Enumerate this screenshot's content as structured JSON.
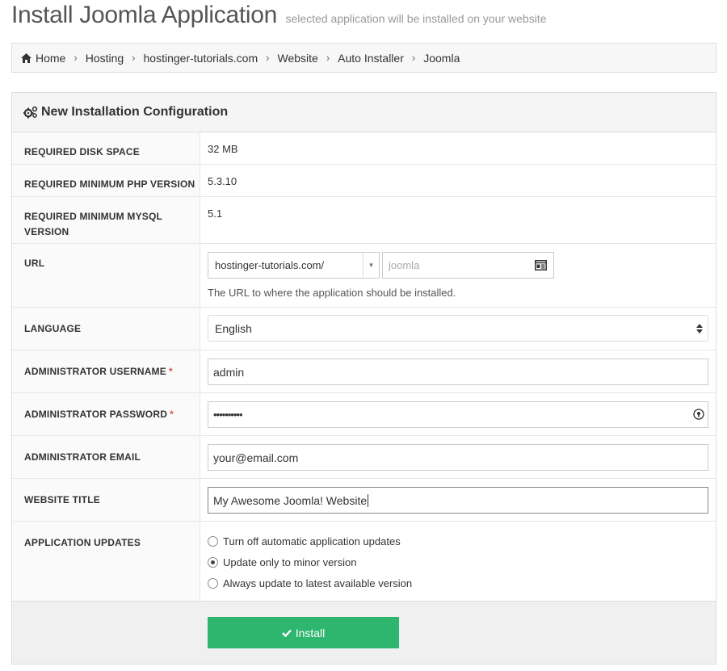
{
  "header": {
    "title": "Install Joomla Application",
    "subtitle": "selected application will be installed on your website"
  },
  "breadcrumb": [
    "Home",
    "Hosting",
    "hostinger-tutorials.com",
    "Website",
    "Auto Installer",
    "Joomla"
  ],
  "panel": {
    "title": "New Installation Configuration",
    "disk_space": {
      "label": "REQUIRED DISK SPACE",
      "value": "32 MB"
    },
    "php_version": {
      "label": "REQUIRED MINIMUM PHP VERSION",
      "value": "5.3.10"
    },
    "mysql_version": {
      "label": "REQUIRED MINIMUM MYSQL VERSION",
      "value": "5.1"
    },
    "url": {
      "label": "URL",
      "domain": "hostinger-tutorials.com/",
      "path_placeholder": "joomla",
      "help": "The URL to where the application should be installed."
    },
    "language": {
      "label": "LANGUAGE",
      "value": "English"
    },
    "admin_username": {
      "label": "ADMINISTRATOR USERNAME",
      "value": "admin",
      "required": "*"
    },
    "admin_password": {
      "label": "ADMINISTRATOR PASSWORD",
      "value": "••••••••••",
      "required": "*"
    },
    "admin_email": {
      "label": "ADMINISTRATOR EMAIL",
      "value": "your@email.com"
    },
    "website_title": {
      "label": "WEBSITE TITLE",
      "value": "My Awesome Joomla! Website"
    },
    "updates": {
      "label": "APPLICATION UPDATES",
      "options": [
        "Turn off automatic application updates",
        "Update only to minor version",
        "Always update to latest available version"
      ],
      "selected_index": 1
    },
    "install_label": "Install"
  },
  "colors": {
    "install_button": "#2eb66f",
    "required_star": "#d9534f"
  }
}
